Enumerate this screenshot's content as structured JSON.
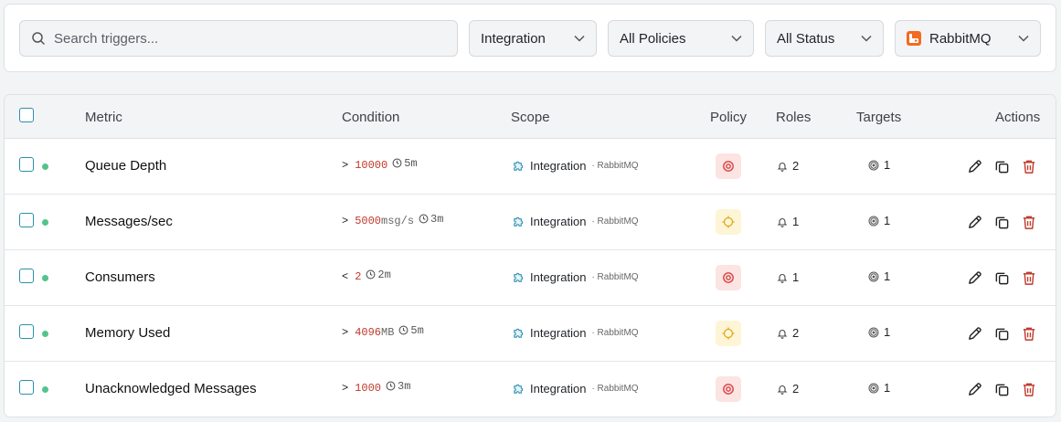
{
  "filters": {
    "search_placeholder": "Search triggers...",
    "scope_select": "Integration",
    "policy_select": "All Policies",
    "status_select": "All Status",
    "integration_select": "RabbitMQ"
  },
  "table": {
    "headers": {
      "metric": "Metric",
      "condition": "Condition",
      "scope": "Scope",
      "policy": "Policy",
      "roles": "Roles",
      "targets": "Targets",
      "actions": "Actions"
    },
    "rows": [
      {
        "metric": "Queue Depth",
        "op": ">",
        "value": "10000",
        "unit": "",
        "duration": "5m",
        "scope": "Integration",
        "scope_sub": "· RabbitMQ",
        "policy": "critical",
        "roles": "2",
        "targets": "1"
      },
      {
        "metric": "Messages/sec",
        "op": ">",
        "value": "5000",
        "unit": "msg/s",
        "duration": "3m",
        "scope": "Integration",
        "scope_sub": "· RabbitMQ",
        "policy": "warning",
        "roles": "1",
        "targets": "1"
      },
      {
        "metric": "Consumers",
        "op": "<",
        "value": "2",
        "unit": "",
        "duration": "2m",
        "scope": "Integration",
        "scope_sub": "· RabbitMQ",
        "policy": "critical",
        "roles": "1",
        "targets": "1"
      },
      {
        "metric": "Memory Used",
        "op": ">",
        "value": "4096",
        "unit": "MB",
        "duration": "5m",
        "scope": "Integration",
        "scope_sub": "· RabbitMQ",
        "policy": "warning",
        "roles": "2",
        "targets": "1"
      },
      {
        "metric": "Unacknowledged Messages",
        "op": ">",
        "value": "1000",
        "unit": "",
        "duration": "3m",
        "scope": "Integration",
        "scope_sub": "· RabbitMQ",
        "policy": "critical",
        "roles": "2",
        "targets": "1"
      }
    ]
  },
  "colors": {
    "accent": "#2b8fb0",
    "status_active": "#52c48a",
    "critical": "#d64545",
    "warning": "#e0a920",
    "delete": "#c0392b",
    "rabbitmq": "#f26b21"
  },
  "icons": {
    "search": "search-icon",
    "chevron": "chevron-down-icon",
    "clock": "clock-icon",
    "integration": "puzzle-icon",
    "bell": "bell-icon",
    "target": "target-icon",
    "edit": "pencil-icon",
    "copy": "copy-icon",
    "delete": "trash-icon"
  }
}
